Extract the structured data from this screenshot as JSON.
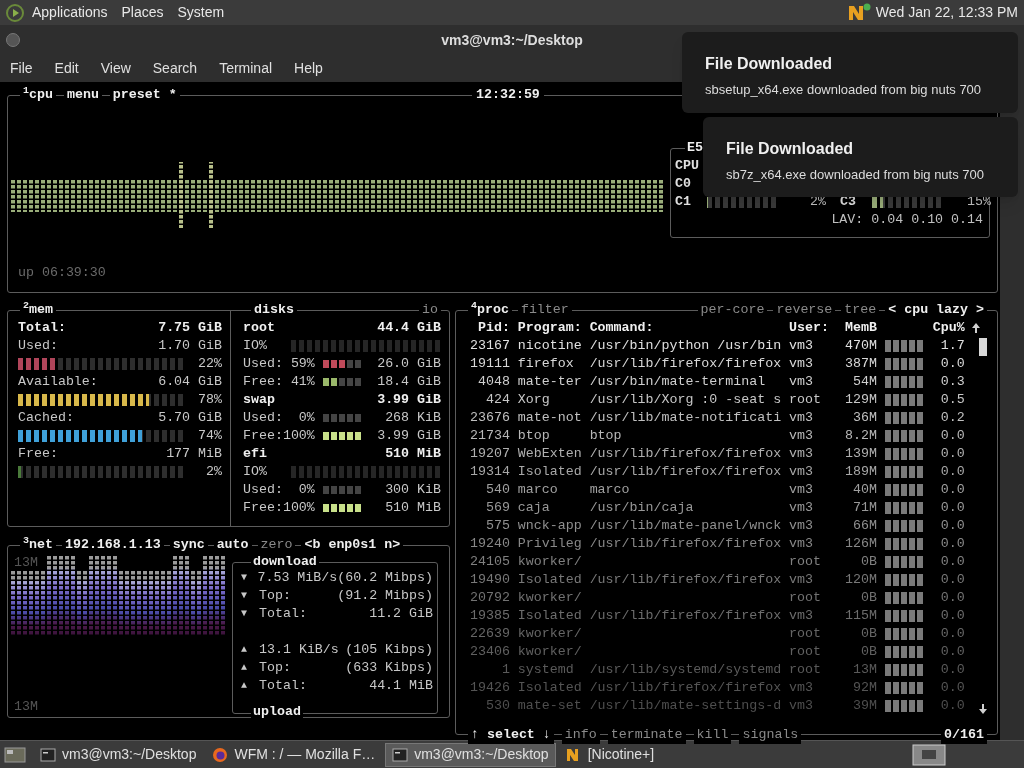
{
  "top_panel": {
    "menus": [
      "Applications",
      "Places",
      "System"
    ],
    "clock": "Wed Jan 22, 12:33 PM"
  },
  "window": {
    "title": "vm3@vm3:~/Desktop",
    "menu": [
      "File",
      "Edit",
      "View",
      "Search",
      "Terminal",
      "Help"
    ]
  },
  "notifications": [
    {
      "title": "File Downloaded",
      "body": "sbsetup_x64.exe downloaded from big nuts 700"
    },
    {
      "title": "File Downloaded",
      "body": "sb7z_x64.exe downloaded from big nuts 700"
    }
  ],
  "cpu": {
    "labels": [
      "$^{1}$cpu",
      "menu",
      "preset *"
    ],
    "clock": "12:32:59",
    "uptime": "up 06:39:30",
    "cores": {
      "model": "E5",
      "labels": [
        "CPU",
        "C0"
      ],
      "meters": [
        {
          "label": "C1",
          "level": 0.02,
          "reading": "2%"
        },
        {
          "label": "C3",
          "level": 0.15,
          "reading": "15%"
        }
      ],
      "load": "LAV: 0.04 0.10 0.14"
    }
  },
  "mem": {
    "title": "$^{2}$mem",
    "rows": [
      {
        "kind": "total",
        "label": "Total:",
        "value": "7.75 GiB"
      },
      {
        "kind": "stat",
        "label": "Used:",
        "value": "1.70 GiB"
      },
      {
        "kind": "meter",
        "level": 0.22,
        "reading": "22%",
        "color": "#b0455a"
      },
      {
        "kind": "stat",
        "label": "Available:",
        "value": "6.04 GiB"
      },
      {
        "kind": "meter",
        "level": 0.78,
        "reading": "78%",
        "color": "#d8b84a"
      },
      {
        "kind": "stat",
        "label": "Cached:",
        "value": "5.70 GiB"
      },
      {
        "kind": "meter",
        "level": 0.74,
        "reading": "74%",
        "color": "#3fa0d8"
      },
      {
        "kind": "stat",
        "label": "Free:",
        "value": "177 MiB"
      },
      {
        "kind": "meter",
        "level": 0.02,
        "reading": "2%",
        "color": "#4a7a3a"
      }
    ]
  },
  "disks": {
    "title": "disks",
    "io_label": "io",
    "rows": [
      {
        "kind": "disk",
        "name": "root",
        "size": "44.4 GiB"
      },
      {
        "kind": "io",
        "label": "IO%"
      },
      {
        "kind": "usage",
        "label": "Used: 59%",
        "level": 0.59,
        "value": "26.0 GiB",
        "color": "#c04a5a"
      },
      {
        "kind": "usage",
        "label": "Free: 41%",
        "level": 0.41,
        "value": "18.4 GiB",
        "color": "#9ab86a"
      },
      {
        "kind": "disk",
        "name": "swap",
        "size": "3.99 GiB"
      },
      {
        "kind": "usage",
        "label": "Used:  0%",
        "level": 0,
        "value": "268 KiB"
      },
      {
        "kind": "usage",
        "label": "Free:100%",
        "level": 1,
        "value": "3.99 GiB",
        "color": "#c8e08a"
      },
      {
        "kind": "disk",
        "name": "efi",
        "size": "510 MiB"
      },
      {
        "kind": "io",
        "label": "IO%"
      },
      {
        "kind": "usage",
        "label": "Used:  0%",
        "level": 0,
        "value": "300 KiB"
      },
      {
        "kind": "usage",
        "label": "Free:100%",
        "level": 1,
        "value": "510 MiB",
        "color": "#c8e08a"
      }
    ]
  },
  "net": {
    "title": "$^{3}$net",
    "labels": [
      {
        "text": "192.168.1.13",
        "active": true
      },
      {
        "text": "sync",
        "active": true
      },
      {
        "text": "auto",
        "active": true
      },
      {
        "text": "zero",
        "active": false
      },
      {
        "text": "<b enp0s1 n>",
        "active": true
      }
    ],
    "scale_top": "13M",
    "scale_bottom": "13M",
    "download": {
      "title": "download",
      "rows": [
        {
          "arrow": "▼",
          "label": "7.53 MiB/s",
          "value": "(60.2 Mibps)"
        },
        {
          "arrow": "▼",
          "label": "Top:",
          "value": "(91.2 Mibps)"
        },
        {
          "arrow": "▼",
          "label": "Total:",
          "value": "11.2 GiB"
        }
      ]
    },
    "upload": {
      "title": "upload",
      "rows": [
        {
          "arrow": "▲",
          "label": "13.1 KiB/s",
          "value": "(105 Kibps)"
        },
        {
          "arrow": "▲",
          "label": "Top:",
          "value": "(633 Kibps)"
        },
        {
          "arrow": "▲",
          "label": "Total:",
          "value": "44.1 MiB"
        }
      ]
    }
  },
  "proc": {
    "title": "$^{4}$proc",
    "labels": [
      {
        "text": "filter",
        "active": false
      },
      {
        "text": "per-core",
        "active": false
      },
      {
        "text": "reverse",
        "active": false
      },
      {
        "text": "tree",
        "active": false
      },
      {
        "text": "< cpu lazy >",
        "active": true
      }
    ],
    "columns": [
      "Pid:",
      "Program:",
      "Command:",
      "User:",
      "MemB",
      "Cpu%"
    ],
    "rows": [
      {
        "pid": "23167",
        "program": "nicotine",
        "command": "/usr/bin/python /usr/bin",
        "user": "vm3",
        "mem": "470M",
        "cpu": "1.7"
      },
      {
        "pid": "19111",
        "program": "firefox",
        "command": "/usr/lib/firefox/firefox",
        "user": "vm3",
        "mem": "387M",
        "cpu": "0.0"
      },
      {
        "pid": "4048",
        "program": "mate-ter",
        "command": "/usr/bin/mate-terminal",
        "user": "vm3",
        "mem": "54M",
        "cpu": "0.3"
      },
      {
        "pid": "424",
        "program": "Xorg",
        "command": "/usr/lib/Xorg :0 -seat s",
        "user": "root",
        "mem": "129M",
        "cpu": "0.5"
      },
      {
        "pid": "23676",
        "program": "mate-not",
        "command": "/usr/lib/mate-notificati",
        "user": "vm3",
        "mem": "36M",
        "cpu": "0.2"
      },
      {
        "pid": "21734",
        "program": "btop",
        "command": "btop",
        "user": "vm3",
        "mem": "8.2M",
        "cpu": "0.0"
      },
      {
        "pid": "19207",
        "program": "WebExten",
        "command": "/usr/lib/firefox/firefox",
        "user": "vm3",
        "mem": "139M",
        "cpu": "0.0"
      },
      {
        "pid": "19314",
        "program": "Isolated",
        "command": "/usr/lib/firefox/firefox",
        "user": "vm3",
        "mem": "189M",
        "cpu": "0.0"
      },
      {
        "pid": "540",
        "program": "marco",
        "command": "marco",
        "user": "vm3",
        "mem": "40M",
        "cpu": "0.0"
      },
      {
        "pid": "569",
        "program": "caja",
        "command": "/usr/bin/caja",
        "user": "vm3",
        "mem": "71M",
        "cpu": "0.0"
      },
      {
        "pid": "575",
        "program": "wnck-app",
        "command": "/usr/lib/mate-panel/wnck",
        "user": "vm3",
        "mem": "66M",
        "cpu": "0.0"
      },
      {
        "pid": "19240",
        "program": "Privileg",
        "command": "/usr/lib/firefox/firefox",
        "user": "vm3",
        "mem": "126M",
        "cpu": "0.0"
      },
      {
        "pid": "24105",
        "program": "kworker/",
        "user": "root",
        "mem": "0B",
        "cpu": "0.0"
      },
      {
        "pid": "19490",
        "program": "Isolated",
        "command": "/usr/lib/firefox/firefox",
        "user": "vm3",
        "mem": "120M",
        "cpu": "0.0"
      },
      {
        "pid": "20792",
        "program": "kworker/",
        "user": "root",
        "mem": "0B",
        "cpu": "0.0"
      },
      {
        "pid": "19385",
        "program": "Isolated",
        "command": "/usr/lib/firefox/firefox",
        "user": "vm3",
        "mem": "115M",
        "cpu": "0.0"
      },
      {
        "pid": "22639",
        "program": "kworker/",
        "user": "root",
        "mem": "0B",
        "cpu": "0.0"
      },
      {
        "pid": "23406",
        "program": "kworker/",
        "user": "root",
        "mem": "0B",
        "cpu": "0.0"
      },
      {
        "pid": "1",
        "program": "systemd",
        "command": "/usr/lib/systemd/systemd",
        "user": "root",
        "mem": "13M",
        "cpu": "0.0"
      },
      {
        "pid": "19426",
        "program": "Isolated",
        "command": "/usr/lib/firefox/firefox",
        "user": "vm3",
        "mem": "92M",
        "cpu": "0.0"
      },
      {
        "pid": "530",
        "program": "mate-set",
        "command": "/usr/lib/mate-settings-d",
        "user": "vm3",
        "mem": "39M",
        "cpu": "0.0"
      }
    ],
    "footer": [
      {
        "text": "↑ select ↓",
        "active": true
      },
      {
        "text": "info",
        "active": false
      },
      {
        "text": "terminate",
        "active": false
      },
      {
        "text": "kill",
        "active": false
      },
      {
        "text": "signals",
        "active": false
      }
    ],
    "count": "0/161"
  },
  "taskbar": {
    "items": [
      {
        "kind": "terminal",
        "label": "vm3@vm3:~/Desktop",
        "selected": false
      },
      {
        "kind": "browser",
        "label": "WFM : / — Mozilla F…",
        "selected": false
      },
      {
        "kind": "terminal",
        "label": "vm3@vm3:~/Desktop",
        "selected": true
      },
      {
        "kind": "nicotine",
        "label": "[Nicotine+]",
        "selected": false
      }
    ]
  }
}
